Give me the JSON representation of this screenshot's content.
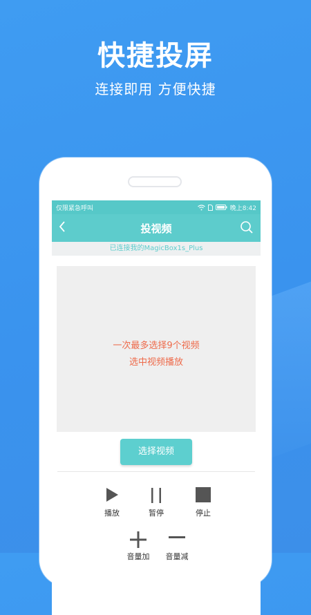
{
  "promo": {
    "headline": "快捷投屏",
    "subline": "连接即用  方便快捷"
  },
  "status_bar": {
    "left": "仅限紧急呼叫",
    "time": "晚上8:42"
  },
  "app_bar": {
    "title": "投视频"
  },
  "connection": {
    "text": "已连接我的MagicBox1s_Plus"
  },
  "video_area": {
    "line1": "一次最多选择9个视频",
    "line2": "选中视频播放"
  },
  "select_button": {
    "label": "选择视频"
  },
  "controls": {
    "play": "播放",
    "pause": "暂停",
    "stop": "停止",
    "volume_up": "音量加",
    "volume_down": "音量减"
  },
  "colors": {
    "background": "#3f9cf2",
    "accent": "#5dcccc",
    "message": "#ee6a4a"
  }
}
